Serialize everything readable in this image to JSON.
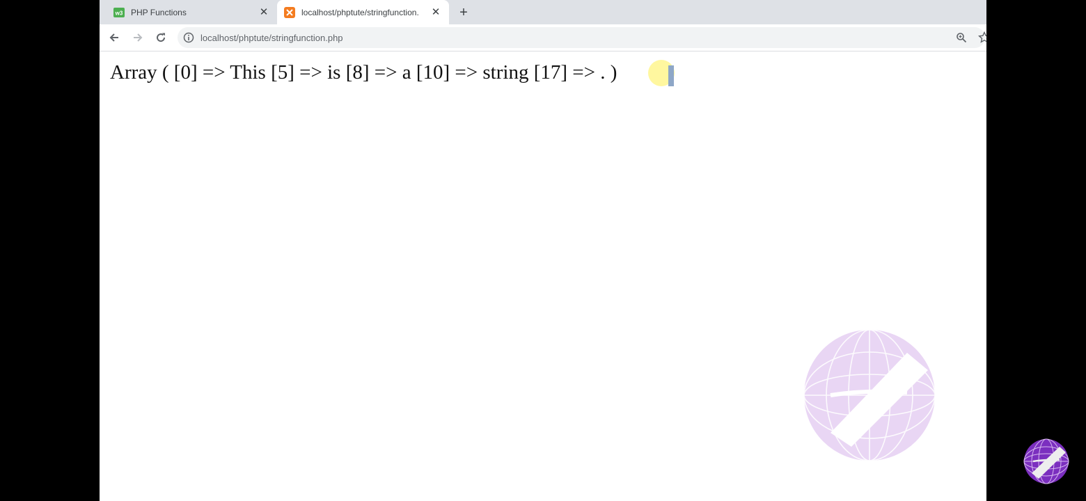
{
  "browser": {
    "tabs": [
      {
        "title": "PHP Functions",
        "active": false,
        "icon": "w3-favicon-icon"
      },
      {
        "title": "localhost/phptute/stringfunction.",
        "active": true,
        "icon": "xampp-favicon-icon"
      }
    ],
    "new_tab_icon": "plus-icon",
    "nav": {
      "back_icon": "back-arrow-icon",
      "forward_icon": "forward-arrow-icon",
      "reload_icon": "reload-icon"
    },
    "address": {
      "url": "localhost/phptute/stringfunction.php",
      "info_icon": "info-icon"
    },
    "toolbar_icons": [
      "zoom-icon",
      "bookmark-star-icon"
    ]
  },
  "page": {
    "output_text": "Array ( [0] => This [5] => is [8] => a [10] => string [17] => . )"
  },
  "overlay": {
    "watermark": "globe-logo-watermark",
    "corner_logo": "globe-logo-icon"
  },
  "colors": {
    "tabstrip": "#dee1e6",
    "omnibox": "#f1f3f4",
    "logo_purple": "#8b3fc9"
  }
}
